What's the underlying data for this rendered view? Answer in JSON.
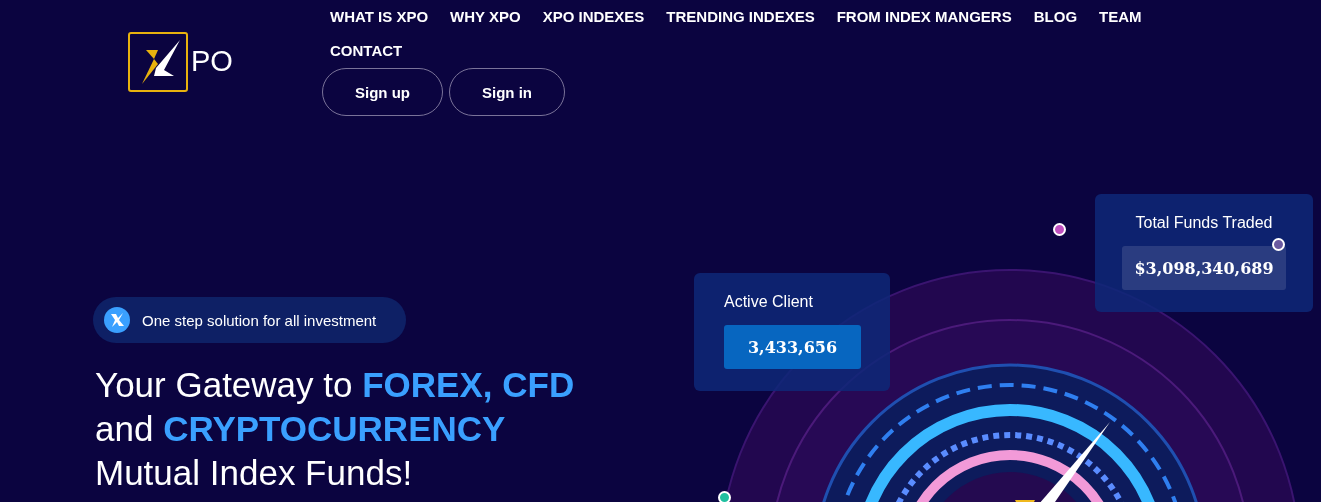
{
  "logo": {
    "text": "PO"
  },
  "nav": [
    "WHAT IS XPO",
    "WHY XPO",
    "XPO INDEXES",
    "TRENDING INDEXES",
    "FROM INDEX MANGERS",
    "BLOG",
    "TEAM",
    "CONTACT"
  ],
  "auth_buttons": [
    "Sign up",
    "Sign in"
  ],
  "hero": {
    "badge": "One step solution for all investment",
    "headline_lines": [
      "Your Gateway to **FOREX, CFD**",
      "and **CRYPTOCURRENCY**",
      "Mutual Index Funds!"
    ]
  },
  "stats": [
    {
      "label": "Active Client",
      "value": "3,433,656",
      "kind": "solid"
    },
    {
      "label": "Total Funds Traded",
      "value": "$3,098,340,689",
      "kind": "muted"
    }
  ]
}
